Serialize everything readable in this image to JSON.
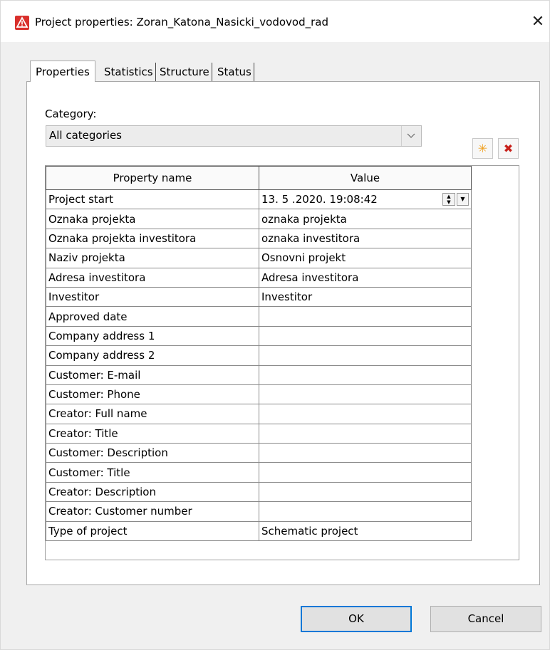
{
  "window": {
    "title": "Project properties: Zoran_Katona_Nasicki_vodovod_rad",
    "close_glyph": "✕",
    "app_icon": "warning-triangle-icon"
  },
  "tabs": [
    {
      "label": "Properties",
      "active": true
    },
    {
      "label": "Statistics",
      "active": false
    },
    {
      "label": "Structure",
      "active": false
    },
    {
      "label": "Status",
      "active": false
    }
  ],
  "category": {
    "label": "Category:",
    "selected": "All categories"
  },
  "toolbar": {
    "new_icon": "new-star-icon",
    "delete_icon": "delete-x-icon"
  },
  "grid": {
    "headers": {
      "name": "Property name",
      "value": "Value"
    },
    "rows": [
      {
        "name": "Project start",
        "value": "13. 5 .2020. 19:08:42"
      },
      {
        "name": "Oznaka projekta",
        "value": "oznaka projekta"
      },
      {
        "name": "Oznaka projekta investitora",
        "value": "oznaka investitora"
      },
      {
        "name": "Naziv projekta",
        "value": "Osnovni projekt"
      },
      {
        "name": "Adresa investitora",
        "value": "Adresa investitora"
      },
      {
        "name": "Investitor",
        "value": "Investitor"
      },
      {
        "name": "Approved date",
        "value": ""
      },
      {
        "name": "Company address 1",
        "value": ""
      },
      {
        "name": "Company address 2",
        "value": ""
      },
      {
        "name": "Customer: E-mail",
        "value": ""
      },
      {
        "name": "Customer: Phone",
        "value": ""
      },
      {
        "name": "Creator: Full name",
        "value": ""
      },
      {
        "name": "Creator: Title",
        "value": ""
      },
      {
        "name": "Customer: Description",
        "value": ""
      },
      {
        "name": "Customer: Title",
        "value": ""
      },
      {
        "name": "Creator: Description",
        "value": ""
      },
      {
        "name": "Creator: Customer number",
        "value": ""
      },
      {
        "name": "Type of project",
        "value": "Schematic project"
      }
    ]
  },
  "buttons": {
    "ok": "OK",
    "cancel": "Cancel"
  },
  "colors": {
    "accent": "#0078d7",
    "app_icon": "#d9302c",
    "new_icon": "#f0a020",
    "delete_icon": "#c8201a"
  }
}
